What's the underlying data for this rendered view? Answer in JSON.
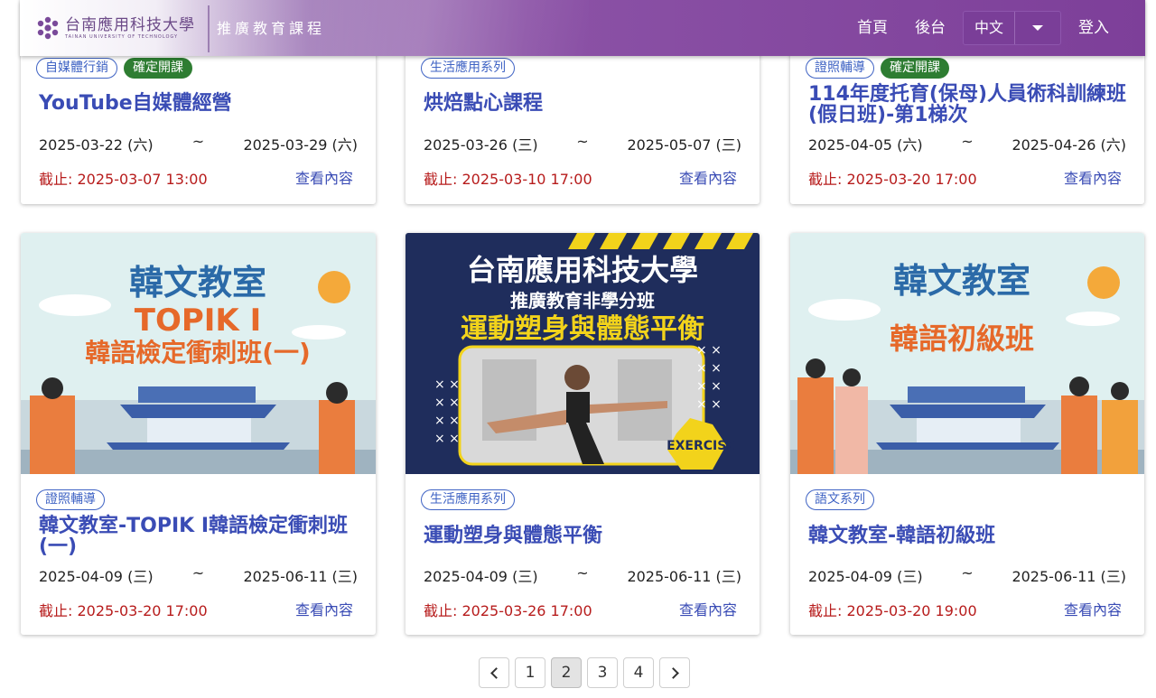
{
  "header": {
    "logo_zh": "台南應用科技大學",
    "logo_en": "TAINAN UNIVERSITY OF TECHNOLOGY",
    "site_title": "推廣教育課程",
    "nav_home": "首頁",
    "nav_admin": "後台",
    "language": "中文",
    "nav_login": "登入"
  },
  "cards": [
    {
      "tags": [
        "自媒體行銷",
        "確定開課"
      ],
      "title": "YouTube自媒體經營",
      "start": "2025-03-22 (六)",
      "sep": "~",
      "end": "2025-03-29 (六)",
      "deadline": "截止: 2025-03-07 13:00",
      "view": "查看內容"
    },
    {
      "tags": [
        "生活應用系列"
      ],
      "title": "烘焙點心課程",
      "start": "2025-03-26 (三)",
      "sep": "~",
      "end": "2025-05-07 (三)",
      "deadline": "截止: 2025-03-10 17:00",
      "view": "查看內容"
    },
    {
      "tags": [
        "證照輔導",
        "確定開課"
      ],
      "title": "114年度托育(保母)人員術科訓練班(假日班)-第1梯次",
      "start": "2025-04-05 (六)",
      "sep": "~",
      "end": "2025-04-26 (六)",
      "deadline": "截止: 2025-03-20 17:00",
      "view": "查看內容"
    },
    {
      "image_text": [
        "韓文教室",
        "TOPIK I",
        "韓語檢定衝刺班(一)"
      ],
      "tags": [
        "證照輔導"
      ],
      "title": "韓文教室-TOPIK I韓語檢定衝刺班(一)",
      "start": "2025-04-09 (三)",
      "sep": "~",
      "end": "2025-06-11 (三)",
      "deadline": "截止: 2025-03-20 17:00",
      "view": "查看內容"
    },
    {
      "image_text": [
        "台南應用科技大學",
        "推廣教育非學分班",
        "運動塑身與體態平衡",
        "EXERCISE"
      ],
      "tags": [
        "生活應用系列"
      ],
      "title": "運動塑身與體態平衡",
      "start": "2025-04-09 (三)",
      "sep": "~",
      "end": "2025-06-11 (三)",
      "deadline": "截止: 2025-03-26 17:00",
      "view": "查看內容"
    },
    {
      "image_text": [
        "韓文教室",
        "韓語初級班"
      ],
      "tags": [
        "語文系列"
      ],
      "title": "韓文教室-韓語初級班",
      "start": "2025-04-09 (三)",
      "sep": "~",
      "end": "2025-06-11 (三)",
      "deadline": "截止: 2025-03-20 19:00",
      "view": "查看內容"
    }
  ],
  "pagination": {
    "prev_icon": "chevron-left-icon",
    "next_icon": "chevron-right-icon",
    "pages": [
      "1",
      "2",
      "3",
      "4"
    ],
    "current": "2"
  },
  "colors": {
    "header_purple": "#7d3f99",
    "title_blue": "#3a4cb5",
    "tag_green": "#2e7d32",
    "deadline_red": "#b71c1c"
  }
}
